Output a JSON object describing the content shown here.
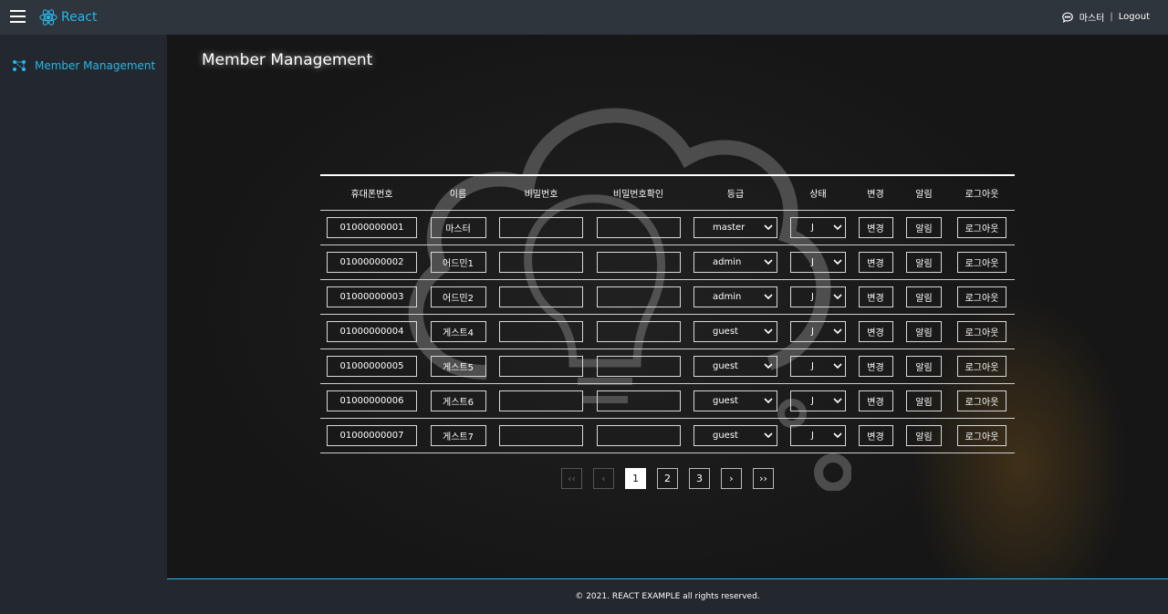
{
  "header": {
    "brand": "React",
    "user_name": "마스터",
    "separator": "|",
    "logout_label": "Logout",
    "accent_color": "#27b7e8"
  },
  "sidebar": {
    "items": [
      {
        "label": "Member Management",
        "icon": "network-icon"
      }
    ]
  },
  "main": {
    "title": "Member Management"
  },
  "table": {
    "headers": [
      "휴대폰번호",
      "이름",
      "비밀번호",
      "비밀번호확인",
      "등급",
      "상태",
      "변경",
      "알림",
      "로그아웃"
    ],
    "rows": [
      {
        "phone": "01000000001",
        "name": "마스터",
        "password": "",
        "password_confirm": "",
        "grade": "master",
        "status": "J",
        "change": "변경",
        "notify": "알림",
        "logout": "로그아웃"
      },
      {
        "phone": "01000000002",
        "name": "어드민1",
        "password": "",
        "password_confirm": "",
        "grade": "admin",
        "status": "J",
        "change": "변경",
        "notify": "알림",
        "logout": "로그아웃"
      },
      {
        "phone": "01000000003",
        "name": "어드민2",
        "password": "",
        "password_confirm": "",
        "grade": "admin",
        "status": "J",
        "change": "변경",
        "notify": "알림",
        "logout": "로그아웃"
      },
      {
        "phone": "01000000004",
        "name": "게스트4",
        "password": "",
        "password_confirm": "",
        "grade": "guest",
        "status": "J",
        "change": "변경",
        "notify": "알림",
        "logout": "로그아웃"
      },
      {
        "phone": "01000000005",
        "name": "게스트5",
        "password": "",
        "password_confirm": "",
        "grade": "guest",
        "status": "J",
        "change": "변경",
        "notify": "알림",
        "logout": "로그아웃"
      },
      {
        "phone": "01000000006",
        "name": "게스트6",
        "password": "",
        "password_confirm": "",
        "grade": "guest",
        "status": "J",
        "change": "변경",
        "notify": "알림",
        "logout": "로그아웃"
      },
      {
        "phone": "01000000007",
        "name": "게스트7",
        "password": "",
        "password_confirm": "",
        "grade": "guest",
        "status": "J",
        "change": "변경",
        "notify": "알림",
        "logout": "로그아웃"
      }
    ]
  },
  "pagination": {
    "first": "‹‹",
    "prev": "‹",
    "pages": [
      "1",
      "2",
      "3"
    ],
    "current": "1",
    "next": "›",
    "last": "››"
  },
  "footer": {
    "copyright": "© 2021. REACT EXAMPLE all rights reserved."
  }
}
